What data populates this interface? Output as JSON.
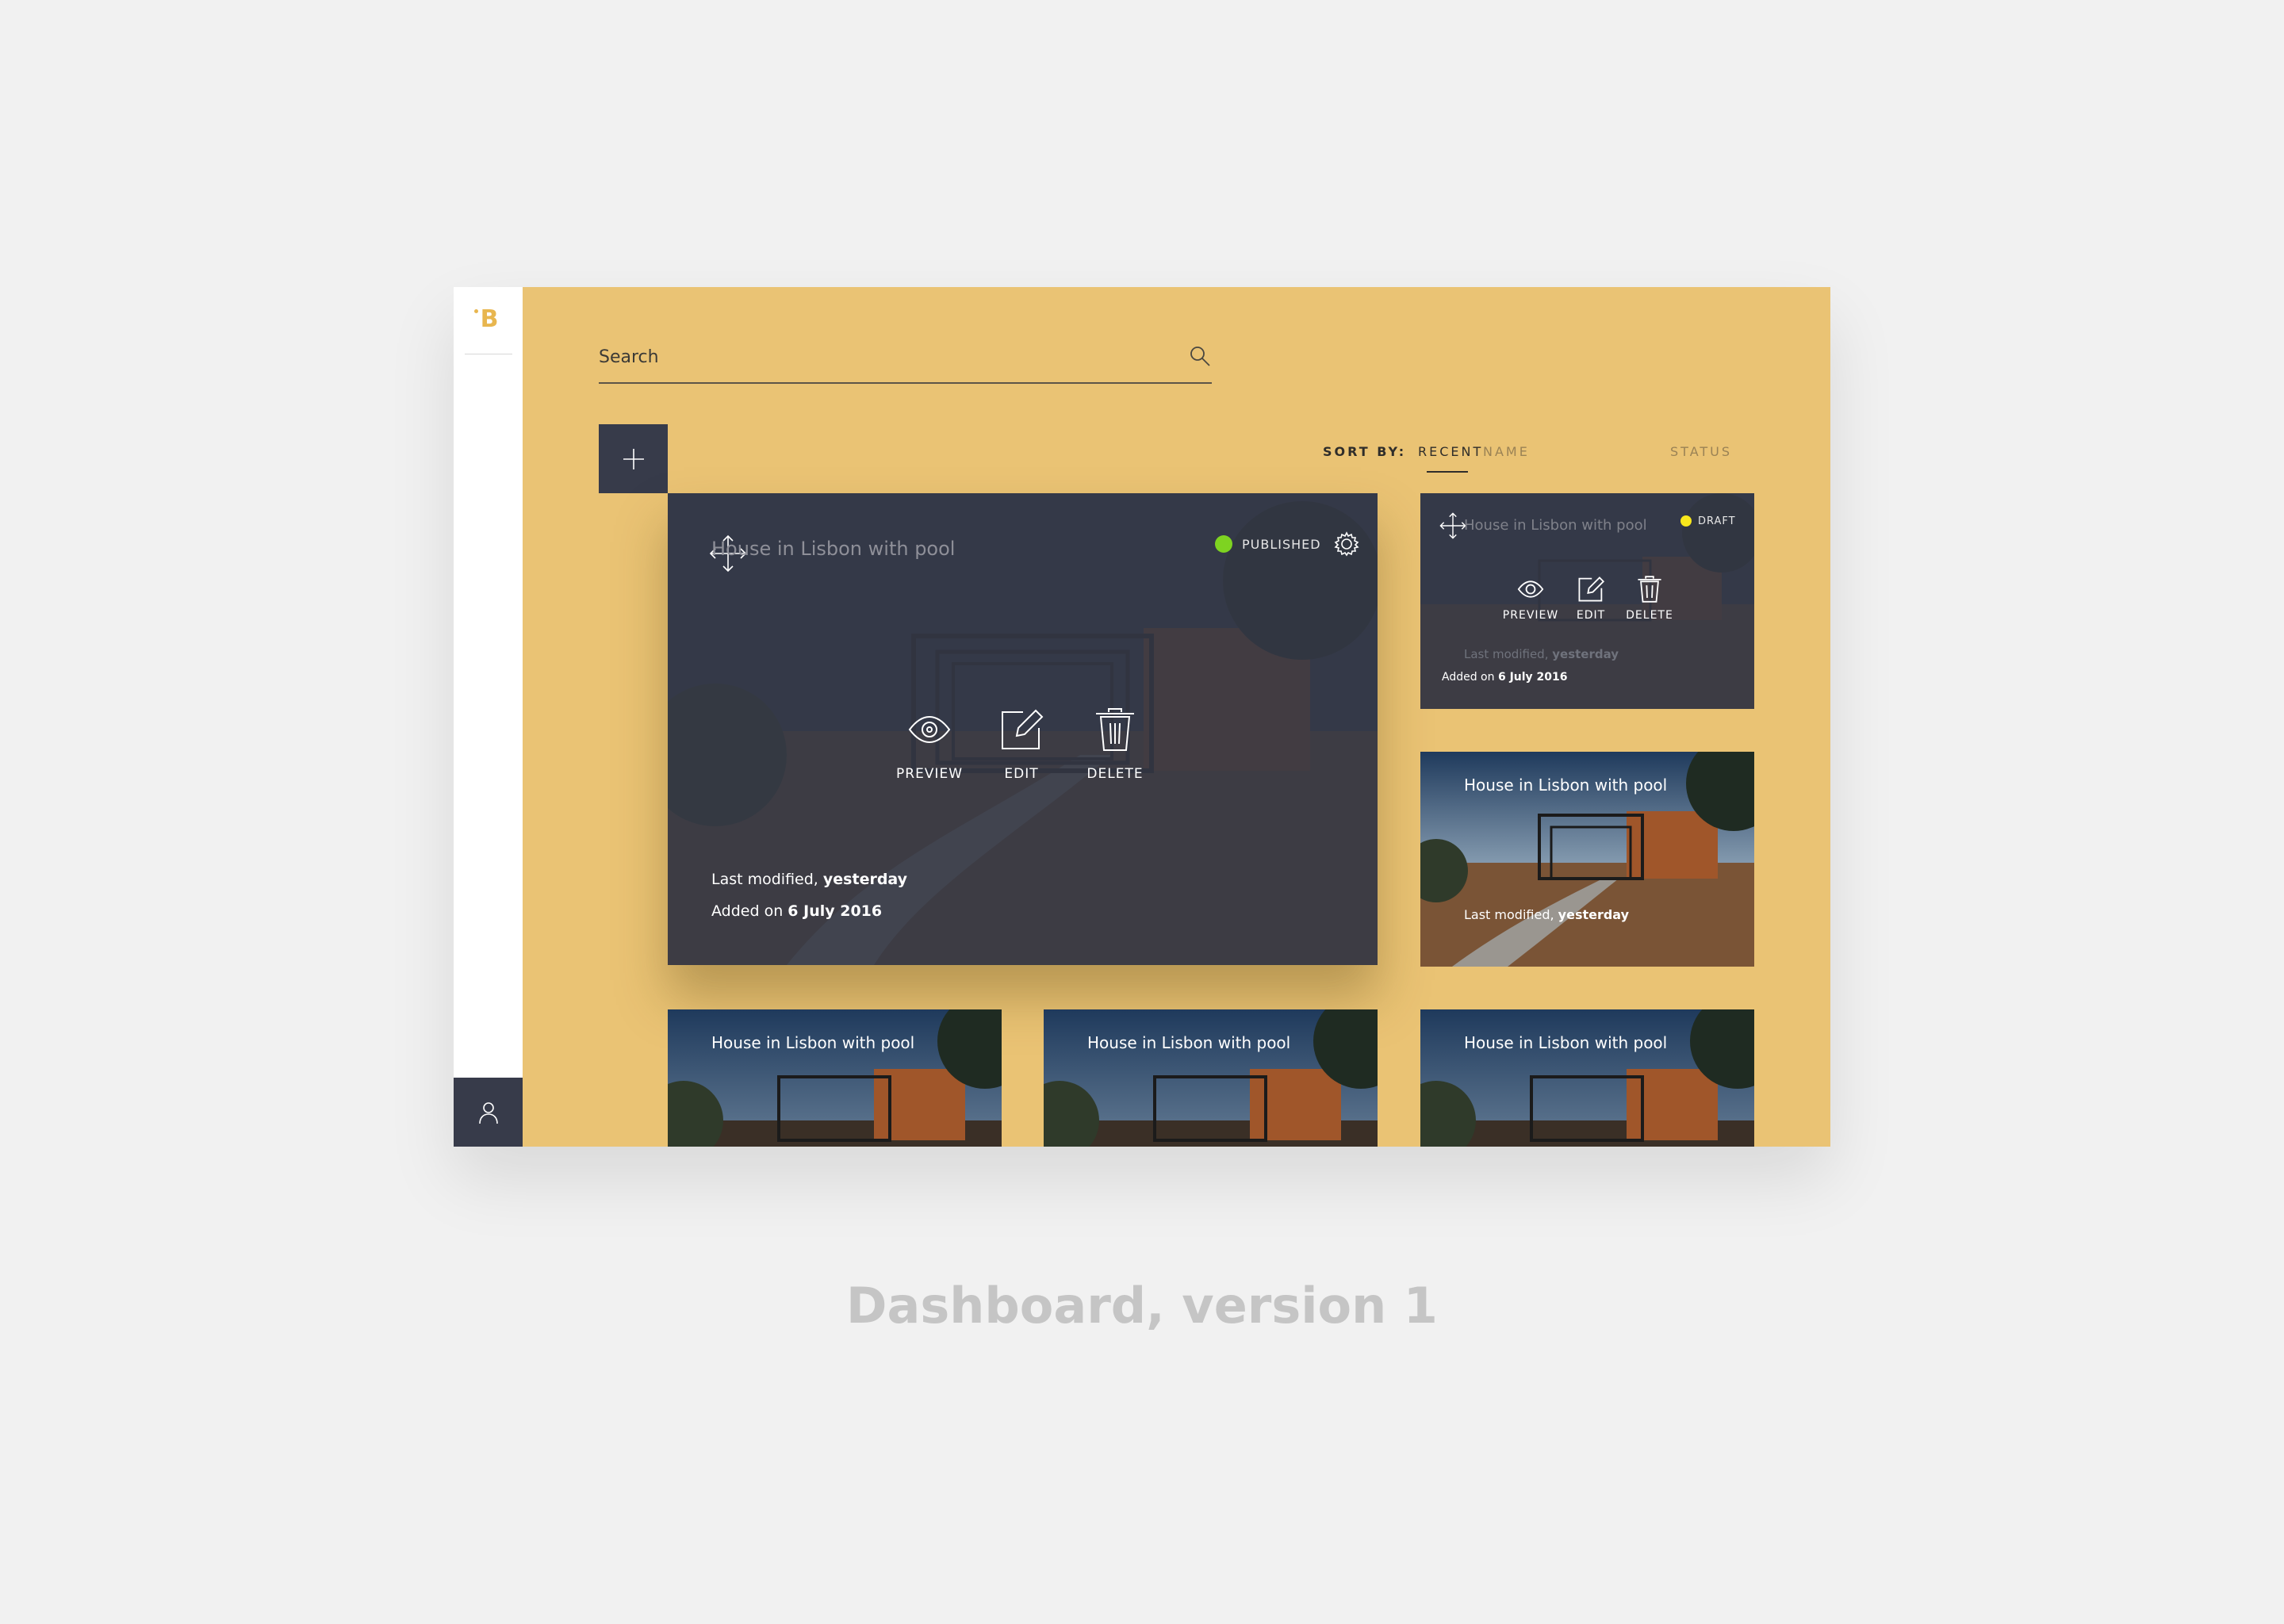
{
  "search": {
    "placeholder": "Search"
  },
  "sort": {
    "label": "SORT BY:",
    "options": [
      {
        "label": "NAME"
      },
      {
        "label": "RECENT"
      },
      {
        "label": "STATUS"
      }
    ],
    "active": "RECENT"
  },
  "actions": {
    "preview": "PREVIEW",
    "edit": "EDIT",
    "delete": "DELETE"
  },
  "featured": {
    "title": "House in Lisbon with pool",
    "status": "PUBLISHED",
    "status_color": "#7ed321",
    "modified_prefix": "Last modified,",
    "modified_value": "yesterday",
    "added_prefix": "Added on",
    "added_value": "6 July 2016"
  },
  "draft_card": {
    "title": "House in Lisbon with pool",
    "status": "DRAFT",
    "status_color": "#f8e71c",
    "modified_prefix": "Last modified,",
    "modified_value": "yesterday",
    "added_prefix": "Added on",
    "added_value": "6 July 2016"
  },
  "card_2": {
    "title": "House in Lisbon with pool",
    "modified_prefix": "Last modified,",
    "modified_value": "yesterday"
  },
  "grid_cards": [
    {
      "title": "House in Lisbon with pool"
    },
    {
      "title": "House in Lisbon with pool"
    },
    {
      "title": "House in Lisbon with pool"
    }
  ],
  "caption": "Dashboard, version 1",
  "colors": {
    "accent": "#eac374",
    "dark": "#373b4a",
    "logo": "#e8b64f"
  }
}
